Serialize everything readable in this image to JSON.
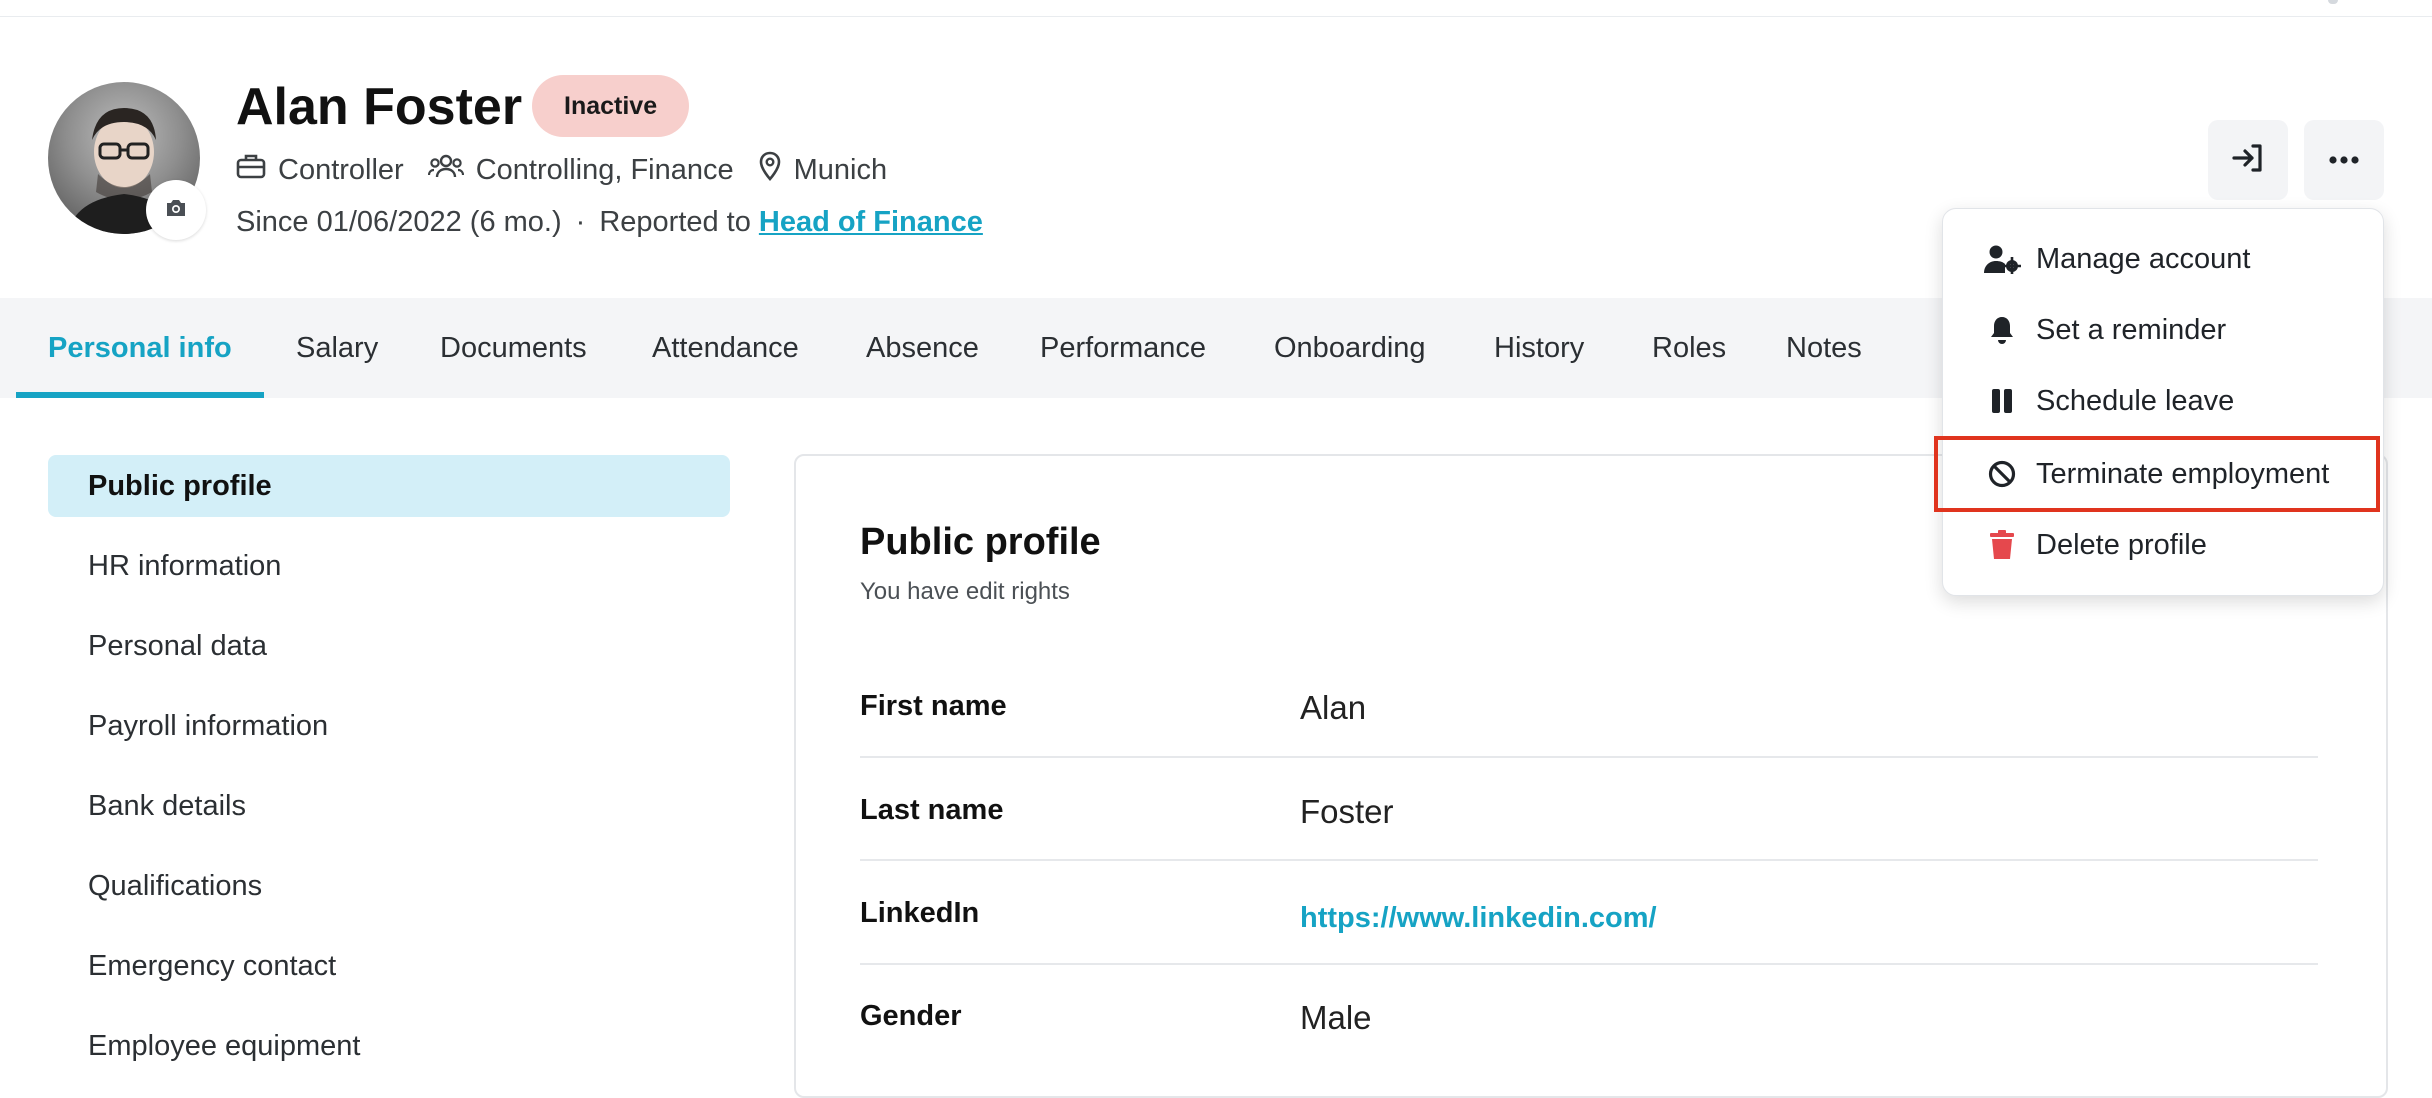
{
  "profile": {
    "name": "Alan Foster",
    "status": "Inactive",
    "role": "Controller",
    "department": "Controlling, Finance",
    "location": "Munich",
    "since": "Since 01/06/2022 (6 mo.)",
    "separator": "·",
    "reported_to_label": "Reported to",
    "reported_to_link": "Head of Finance"
  },
  "tabs": [
    {
      "label": "Personal info"
    },
    {
      "label": "Salary"
    },
    {
      "label": "Documents"
    },
    {
      "label": "Attendance"
    },
    {
      "label": "Absence"
    },
    {
      "label": "Performance"
    },
    {
      "label": "Onboarding"
    },
    {
      "label": "History"
    },
    {
      "label": "Roles"
    },
    {
      "label": "Notes"
    }
  ],
  "sidebar": {
    "items": [
      {
        "label": "Public profile"
      },
      {
        "label": "HR information"
      },
      {
        "label": "Personal data"
      },
      {
        "label": "Payroll information"
      },
      {
        "label": "Bank details"
      },
      {
        "label": "Qualifications"
      },
      {
        "label": "Emergency contact"
      },
      {
        "label": "Employee equipment"
      }
    ]
  },
  "card": {
    "title": "Public profile",
    "subtitle": "You have edit rights",
    "fields": [
      {
        "label": "First name",
        "value": "Alan"
      },
      {
        "label": "Last name",
        "value": "Foster"
      },
      {
        "label": "LinkedIn",
        "value": "https://www.linkedin.com/"
      },
      {
        "label": "Gender",
        "value": "Male"
      }
    ]
  },
  "menu": {
    "items": [
      {
        "label": "Manage account",
        "icon": "user-gear-icon"
      },
      {
        "label": "Set a reminder",
        "icon": "bell-icon"
      },
      {
        "label": "Schedule leave",
        "icon": "pause-icon"
      },
      {
        "label": "Terminate employment",
        "icon": "ban-icon"
      },
      {
        "label": "Delete profile",
        "icon": "trash-icon"
      }
    ]
  },
  "colors": {
    "accent": "#16a3c4",
    "badge_bg": "#f7cfcc",
    "highlight": "#e0341e",
    "danger_icon": "#e5484d"
  }
}
